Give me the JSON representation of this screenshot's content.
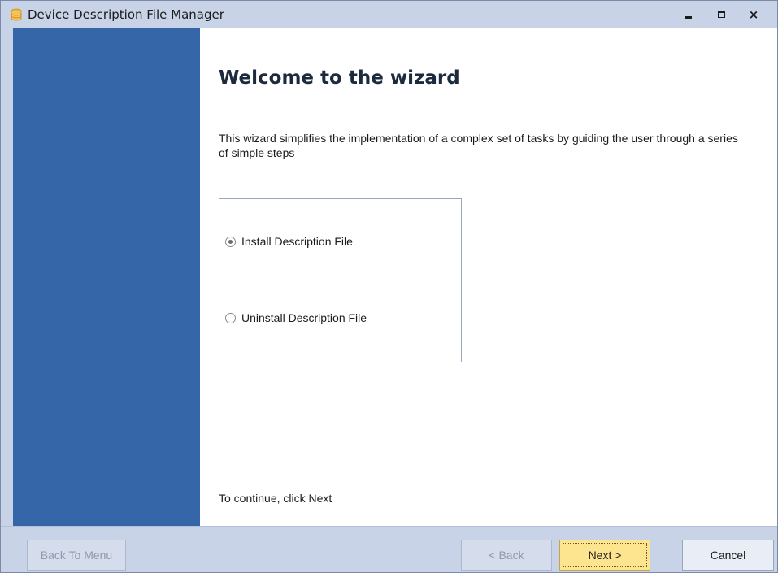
{
  "window": {
    "title": "Device Description File Manager",
    "app_icon": "database-icon",
    "controls": {
      "minimize_icon": "minimize-icon",
      "maximize_icon": "maximize-icon",
      "close_glyph": "×"
    }
  },
  "wizard": {
    "title": "Welcome to the wizard",
    "description": "This wizard simplifies the implementation of a complex set of tasks by guiding the user through a series of simple steps",
    "options": [
      {
        "label": "Install Description File",
        "selected": true
      },
      {
        "label": "Uninstall Description File",
        "selected": false
      }
    ],
    "continue_hint": "To continue, click Next"
  },
  "footer": {
    "back_to_menu_label": "Back To Menu",
    "back_label": "< Back",
    "next_label": "Next >",
    "cancel_label": "Cancel"
  },
  "colors": {
    "sidebar": "#3566a7",
    "chrome": "#c9d3e8",
    "next_button": "#fde58f",
    "app_icon": "#f0b43c"
  }
}
